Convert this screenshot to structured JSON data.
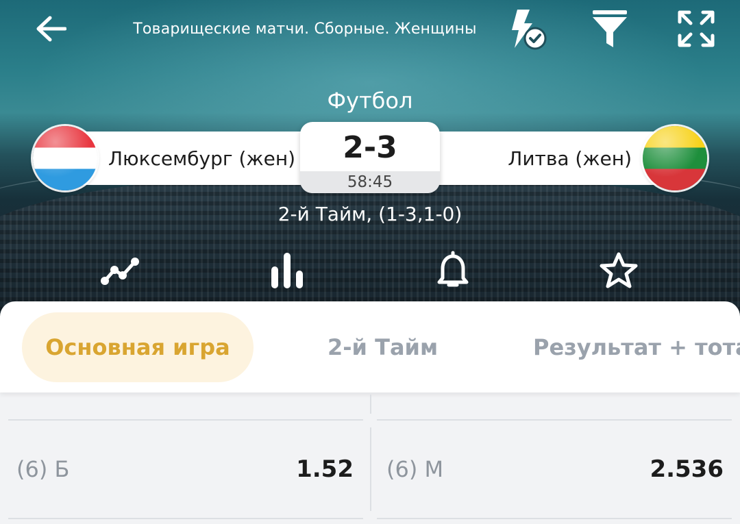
{
  "header": {
    "league": "Товарищеские матчи. Сборные. Женщины",
    "sport": "Футбол",
    "icons": {
      "back": "arrow-left-icon",
      "flash": "lightning-check-icon",
      "filter": "funnel-icon",
      "expand": "expand-icon"
    }
  },
  "match": {
    "home_team": "Люксембург (жен)",
    "away_team": "Литва (жен)",
    "score": "2-3",
    "time": "58:45",
    "period": "2-й Тайм, (1-3,1-0)",
    "home_flag_colors": [
      "#e8363f",
      "#ffffff",
      "#2f9be0"
    ],
    "away_flag_colors": [
      "#f7d21a",
      "#1e8f3c",
      "#d8363a"
    ]
  },
  "actions": {
    "stats": "line-chart-icon",
    "bars": "bar-chart-icon",
    "bell": "bell-icon",
    "star": "star-icon"
  },
  "tabs": [
    {
      "label": "Основная игра",
      "active": true
    },
    {
      "label": "2-й Тайм",
      "active": false
    },
    {
      "label": "Результат + тотал",
      "active": false
    }
  ],
  "odds": [
    {
      "label": "(6) Б",
      "value": "1.52"
    },
    {
      "label": "(6) М",
      "value": "2.536"
    }
  ],
  "colors": {
    "accent": "#d9a531",
    "accent_bg": "#fdf3df",
    "inactive_tab": "#9aa2ac"
  }
}
